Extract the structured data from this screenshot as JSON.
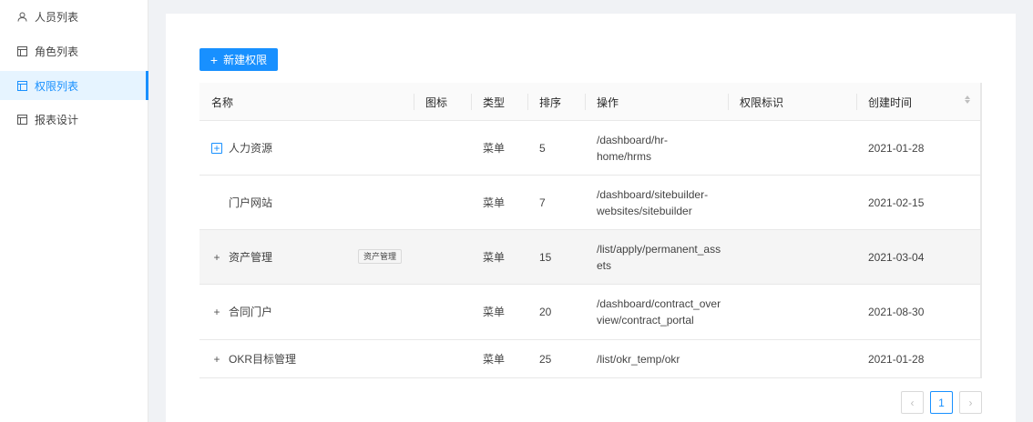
{
  "sidebar": {
    "items": [
      {
        "label": "人员列表",
        "icon": "user-icon",
        "active": false
      },
      {
        "label": "角色列表",
        "icon": "table-icon",
        "active": false
      },
      {
        "label": "权限列表",
        "icon": "table-icon",
        "active": true
      },
      {
        "label": "报表设计",
        "icon": "table-icon",
        "active": false
      }
    ]
  },
  "toolbar": {
    "new_label": "新建权限",
    "new_icon": "plus-icon"
  },
  "table": {
    "columns": [
      "名称",
      "图标",
      "类型",
      "排序",
      "操作",
      "权限标识",
      "创建时间"
    ],
    "rows": [
      {
        "name": "人力资源",
        "icon": "",
        "type": "菜单",
        "order": "5",
        "op_line1": "/dashboard/hr-",
        "op_line2": "home/hrms",
        "perm": "",
        "created": "2021-01-28",
        "expand": "plus-boxed"
      },
      {
        "name": "门户网站",
        "icon": "",
        "type": "菜单",
        "order": "7",
        "op_line1": "/dashboard/sitebuilder-",
        "op_line2": "websites/sitebuilder",
        "perm": "",
        "created": "2021-02-15",
        "expand": "none"
      },
      {
        "name": "资产管理",
        "icon": "资产管理",
        "type": "菜单",
        "order": "15",
        "op_line1": "/list/apply/permanent_ass",
        "op_line2": "ets",
        "perm": "",
        "created": "2021-03-04",
        "expand": "plus"
      },
      {
        "name": "合同门户",
        "icon": "",
        "type": "菜单",
        "order": "20",
        "op_line1": "/dashboard/contract_over",
        "op_line2": "view/contract_portal",
        "perm": "",
        "created": "2021-08-30",
        "expand": "plus"
      },
      {
        "name": "OKR目标管理",
        "icon": "",
        "type": "菜单",
        "order": "25",
        "op_line1": "/list/okr_temp/okr",
        "op_line2": "",
        "perm": "",
        "created": "2021-01-28",
        "expand": "plus"
      }
    ]
  },
  "pagination": {
    "prev_icon": "chevron-left-icon",
    "current_page": "1",
    "next_icon": "chevron-right-icon"
  },
  "colors": {
    "accent": "#1890ff",
    "active_bg": "#e6f4ff",
    "page_bg": "#f0f2f5"
  }
}
